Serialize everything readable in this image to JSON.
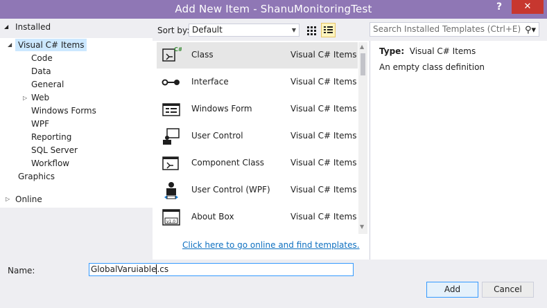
{
  "window": {
    "title": "Add New Item - ShanuMonitoringTest",
    "help_label": "?",
    "close_label": "✕"
  },
  "left_pane": {
    "installed_label": "Installed",
    "tree": [
      {
        "label": "Visual C# Items",
        "selected": true
      },
      {
        "label": "Code"
      },
      {
        "label": "Data"
      },
      {
        "label": "General"
      },
      {
        "label": "Web"
      },
      {
        "label": "Windows Forms"
      },
      {
        "label": "WPF"
      },
      {
        "label": "Reporting"
      },
      {
        "label": "SQL Server"
      },
      {
        "label": "Workflow"
      },
      {
        "label": "Graphics"
      }
    ],
    "online_label": "Online"
  },
  "toolbar": {
    "sort_label": "Sort by:",
    "sort_value": "Default"
  },
  "search": {
    "placeholder": "Search Installed Templates (Ctrl+E)"
  },
  "templates": [
    {
      "name": "Class",
      "category": "Visual C# Items",
      "icon": "class-icon",
      "selected": true
    },
    {
      "name": "Interface",
      "category": "Visual C# Items",
      "icon": "interface-icon"
    },
    {
      "name": "Windows Form",
      "category": "Visual C# Items",
      "icon": "windows-form-icon"
    },
    {
      "name": "User Control",
      "category": "Visual C# Items",
      "icon": "user-control-icon"
    },
    {
      "name": "Component Class",
      "category": "Visual C# Items",
      "icon": "component-class-icon"
    },
    {
      "name": "User Control (WPF)",
      "category": "Visual C# Items",
      "icon": "user-control-wpf-icon"
    },
    {
      "name": "About Box",
      "category": "Visual C# Items",
      "icon": "about-box-icon"
    }
  ],
  "online_link": "Click here to go online and find templates.",
  "details": {
    "type_label": "Type:",
    "type_value": "Visual C# Items",
    "description": "An empty class definition"
  },
  "bottom": {
    "name_label": "Name:",
    "name_value_before_caret": "GlobalVaruiable",
    "name_value_after_caret": ".cs",
    "add_label": "Add",
    "cancel_label": "Cancel"
  },
  "colors": {
    "title_bar": "#8f77b5",
    "close_button": "#c7372f",
    "selection": "#cce8ff",
    "link": "#0e70c0"
  }
}
